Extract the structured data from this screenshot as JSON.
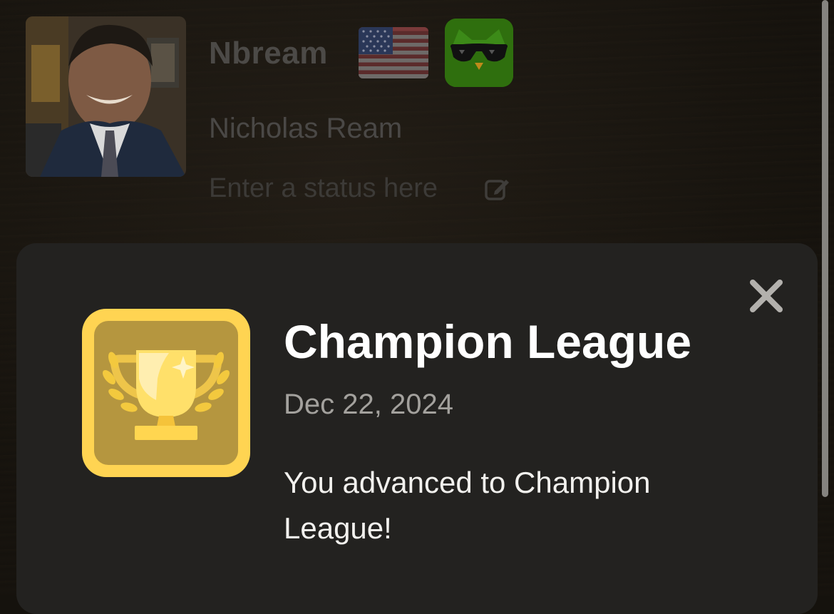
{
  "profile": {
    "username": "Nbream",
    "full_name": "Nicholas Ream",
    "status_placeholder": "Enter a status here",
    "flag_icon": "us-flag-icon",
    "avatar_icon": "owl-sunglasses-icon"
  },
  "achievement": {
    "title": "Champion League",
    "date": "Dec 22, 2024",
    "description": "You advanced to Champion League!",
    "badge_icon": "trophy-icon",
    "badge_color": "#ffd452",
    "close_icon": "close-icon"
  }
}
